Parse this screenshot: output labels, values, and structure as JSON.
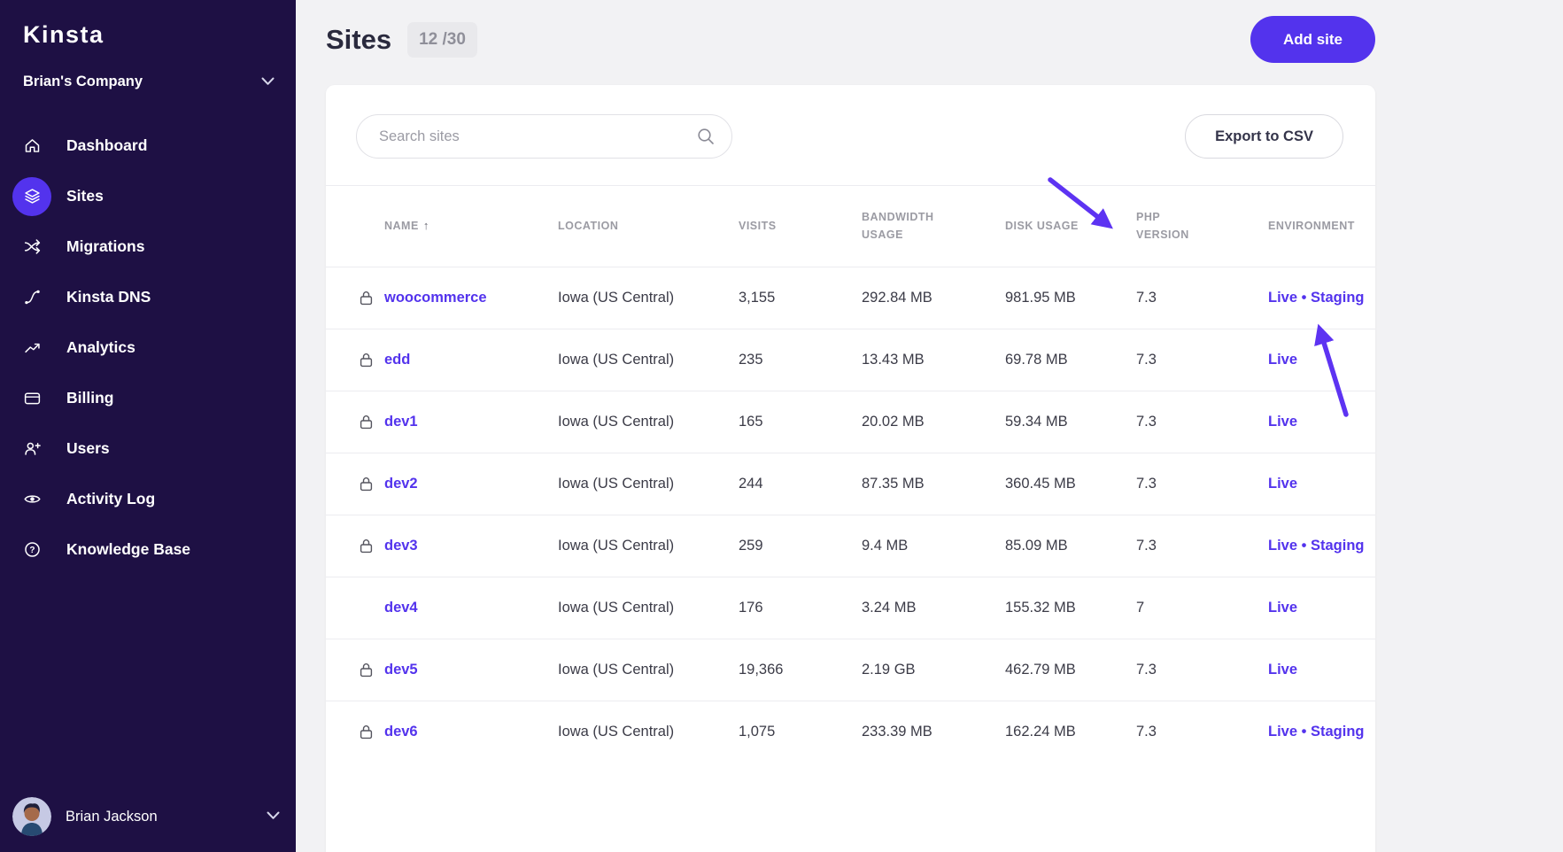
{
  "colors": {
    "accent": "#5333ed",
    "sidebar_bg": "#1e1044",
    "annotation": "#5d33f2"
  },
  "sidebar": {
    "logo": "Kinsta",
    "company": "Brian's Company",
    "items": [
      {
        "label": "Dashboard",
        "icon": "home-icon",
        "active": false
      },
      {
        "label": "Sites",
        "icon": "sites-icon",
        "active": true
      },
      {
        "label": "Migrations",
        "icon": "migrations-icon",
        "active": false
      },
      {
        "label": "Kinsta DNS",
        "icon": "dns-icon",
        "active": false
      },
      {
        "label": "Analytics",
        "icon": "analytics-icon",
        "active": false
      },
      {
        "label": "Billing",
        "icon": "billing-icon",
        "active": false
      },
      {
        "label": "Users",
        "icon": "users-icon",
        "active": false
      },
      {
        "label": "Activity Log",
        "icon": "activity-icon",
        "active": false
      },
      {
        "label": "Knowledge Base",
        "icon": "knowledge-icon",
        "active": false
      }
    ],
    "user": {
      "name": "Brian Jackson"
    }
  },
  "header": {
    "title": "Sites",
    "count": "12 /30",
    "add_site_label": "Add site"
  },
  "toolbar": {
    "search_placeholder": "Search sites",
    "export_label": "Export to CSV"
  },
  "table": {
    "env_separator": "•",
    "columns": [
      {
        "label": "NAME",
        "sorted": true
      },
      {
        "label": "LOCATION"
      },
      {
        "label": "VISITS"
      },
      {
        "label": "BANDWIDTH USAGE"
      },
      {
        "label": "DISK USAGE"
      },
      {
        "label": "PHP VERSION"
      },
      {
        "label": "ENVIRONMENT"
      }
    ],
    "rows": [
      {
        "locked": true,
        "name": "woocommerce",
        "location": "Iowa (US Central)",
        "visits": "3,155",
        "bandwidth": "292.84 MB",
        "disk": "981.95 MB",
        "php": "7.3",
        "environments": [
          "Live",
          "Staging"
        ]
      },
      {
        "locked": true,
        "name": "edd",
        "location": "Iowa (US Central)",
        "visits": "235",
        "bandwidth": "13.43 MB",
        "disk": "69.78 MB",
        "php": "7.3",
        "environments": [
          "Live"
        ]
      },
      {
        "locked": true,
        "name": "dev1",
        "location": "Iowa (US Central)",
        "visits": "165",
        "bandwidth": "20.02 MB",
        "disk": "59.34 MB",
        "php": "7.3",
        "environments": [
          "Live"
        ]
      },
      {
        "locked": true,
        "name": "dev2",
        "location": "Iowa (US Central)",
        "visits": "244",
        "bandwidth": "87.35 MB",
        "disk": "360.45 MB",
        "php": "7.3",
        "environments": [
          "Live"
        ]
      },
      {
        "locked": true,
        "name": "dev3",
        "location": "Iowa (US Central)",
        "visits": "259",
        "bandwidth": "9.4 MB",
        "disk": "85.09 MB",
        "php": "7.3",
        "environments": [
          "Live",
          "Staging"
        ]
      },
      {
        "locked": false,
        "name": "dev4",
        "location": "Iowa (US Central)",
        "visits": "176",
        "bandwidth": "3.24 MB",
        "disk": "155.32 MB",
        "php": "7",
        "environments": [
          "Live"
        ]
      },
      {
        "locked": true,
        "name": "dev5",
        "location": "Iowa (US Central)",
        "visits": "19,366",
        "bandwidth": "2.19 GB",
        "disk": "462.79 MB",
        "php": "7.3",
        "environments": [
          "Live"
        ]
      },
      {
        "locked": true,
        "name": "dev6",
        "location": "Iowa (US Central)",
        "visits": "1,075",
        "bandwidth": "233.39 MB",
        "disk": "162.24 MB",
        "php": "7.3",
        "environments": [
          "Live",
          "Staging"
        ]
      }
    ]
  }
}
